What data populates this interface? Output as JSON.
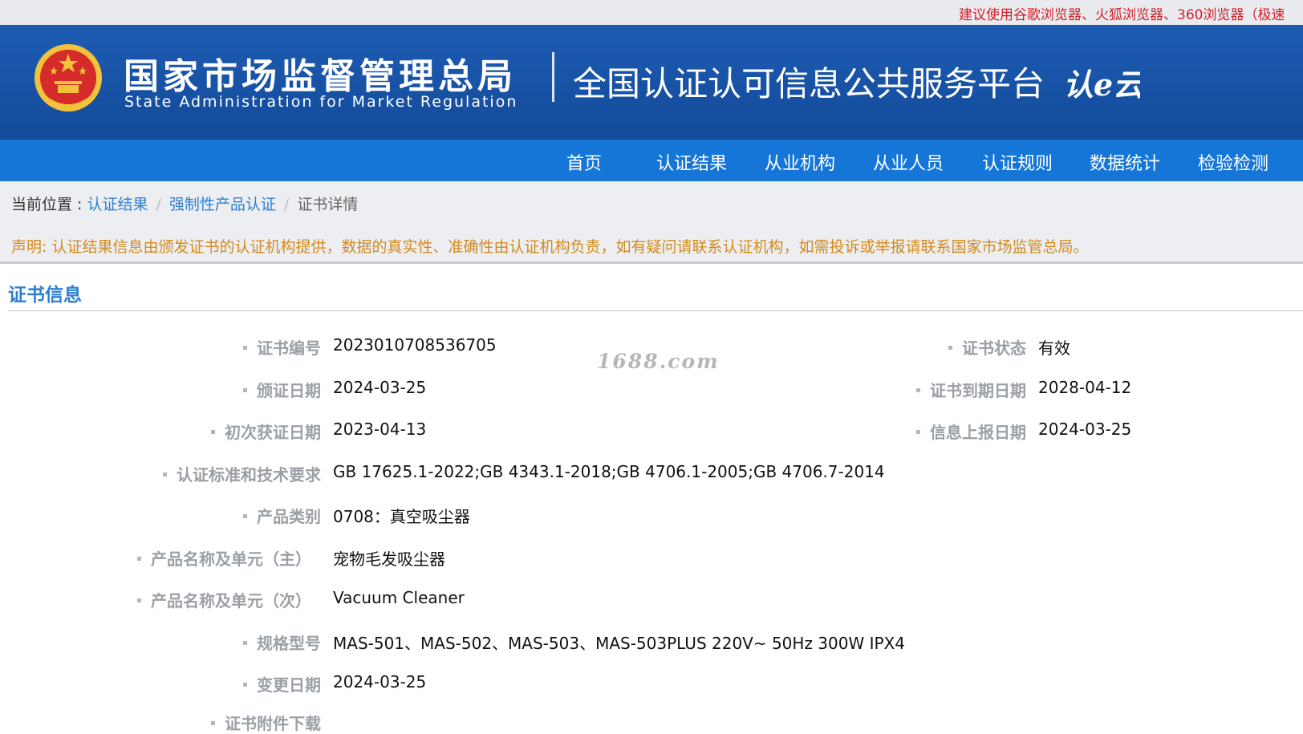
{
  "topbar": {
    "tip": "建议使用谷歌浏览器、火狐浏览器、360浏览器（极速"
  },
  "header": {
    "org_cn": "国家市场监督管理总局",
    "org_en": "State Administration  for  Market Regulation",
    "platform": "全国认证认可信息公共服务平台",
    "logo_text": "认e云"
  },
  "nav": [
    {
      "label": "首页"
    },
    {
      "label": "认证结果"
    },
    {
      "label": "从业机构"
    },
    {
      "label": "从业人员"
    },
    {
      "label": "认证规则"
    },
    {
      "label": "数据统计"
    },
    {
      "label": "检验检测"
    }
  ],
  "breadcrumb": {
    "prefix": "当前位置 : ",
    "items": [
      "认证结果",
      "强制性产品认证",
      "证书详情"
    ],
    "separator": "/"
  },
  "notice": "声明: 认证结果信息由颁发证书的认证机构提供，数据的真实性、准确性由认证机构负责，如有疑问请联系认证机构，如需投诉或举报请联系国家市场监管总局。",
  "section": {
    "title": "证书信息"
  },
  "watermark": "1688.com",
  "certificate": {
    "cert_no": {
      "label": "证书编号",
      "value": "2023010708536705"
    },
    "status": {
      "label": "证书状态",
      "value": "有效"
    },
    "issue_date": {
      "label": "颁证日期",
      "value": "2024-03-25"
    },
    "expiry_date": {
      "label": "证书到期日期",
      "value": "2028-04-12"
    },
    "first_date": {
      "label": "初次获证日期",
      "value": "2023-04-13"
    },
    "report_date": {
      "label": "信息上报日期",
      "value": "2024-03-25"
    },
    "standards": {
      "label": "认证标准和技术要求",
      "value": "GB 17625.1-2022;GB 4343.1-2018;GB 4706.1-2005;GB 4706.7-2014"
    },
    "category": {
      "label": "产品类别",
      "value": "0708：真空吸尘器"
    },
    "product_main": {
      "label": "产品名称及单元（主）",
      "value": "宠物毛发吸尘器"
    },
    "product_sub": {
      "label": "产品名称及单元（次）",
      "value": "Vacuum Cleaner"
    },
    "model": {
      "label": "规格型号",
      "value": "MAS-501、MAS-502、MAS-503、MAS-503PLUS 220V~ 50Hz 300W IPX4"
    },
    "change_date": {
      "label": "变更日期",
      "value": "2024-03-25"
    },
    "attachment": {
      "label": "证书附件下载"
    }
  }
}
